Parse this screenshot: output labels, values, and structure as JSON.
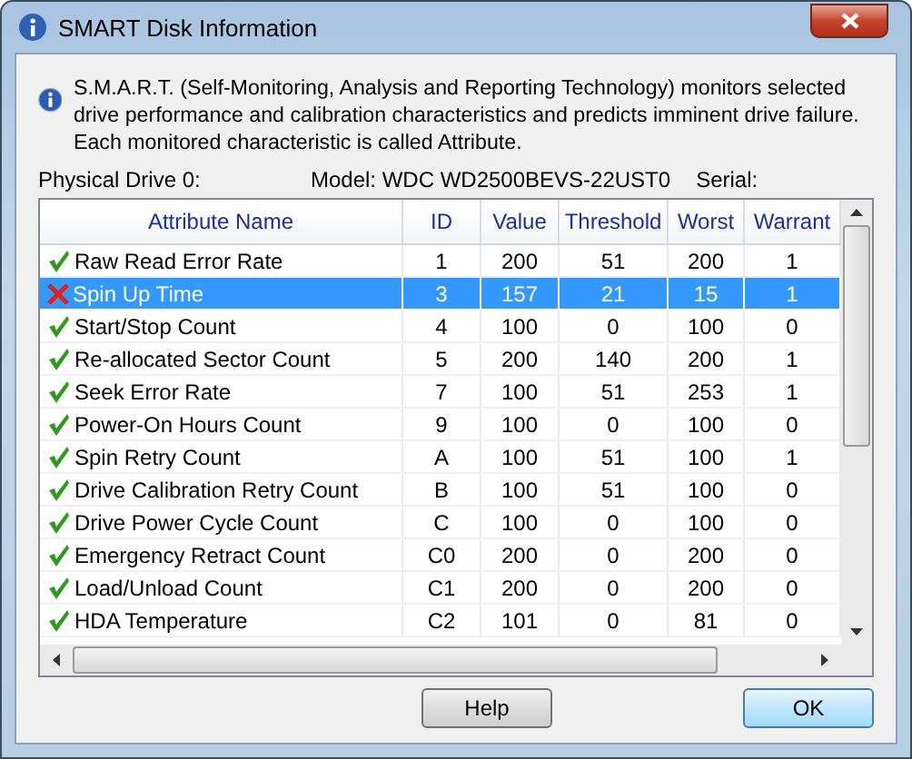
{
  "window": {
    "title": "SMART Disk Information"
  },
  "description": "S.M.A.R.T. (Self-Monitoring, Analysis and Reporting Technology) monitors selected drive performance and calibration characteristics and predicts imminent drive failure. Each monitored characteristic is called Attribute.",
  "drive": {
    "label": "Physical Drive 0:",
    "model": "Model: WDC WD2500BEVS-22UST0",
    "serial_label": "Serial:"
  },
  "table": {
    "columns": [
      "Attribute Name",
      "ID",
      "Value",
      "Threshold",
      "Worst",
      "Warrant"
    ],
    "rows": [
      {
        "kind": "ok",
        "selected": false,
        "cells": [
          "Raw Read Error Rate",
          "1",
          "200",
          "51",
          "200",
          "1"
        ]
      },
      {
        "kind": "fail",
        "selected": true,
        "cells": [
          "Spin Up Time",
          "3",
          "157",
          "21",
          "15",
          "1"
        ]
      },
      {
        "kind": "ok",
        "selected": false,
        "cells": [
          "Start/Stop Count",
          "4",
          "100",
          "0",
          "100",
          "0"
        ]
      },
      {
        "kind": "ok",
        "selected": false,
        "cells": [
          "Re-allocated Sector Count",
          "5",
          "200",
          "140",
          "200",
          "1"
        ]
      },
      {
        "kind": "ok",
        "selected": false,
        "cells": [
          "Seek Error Rate",
          "7",
          "100",
          "51",
          "253",
          "1"
        ]
      },
      {
        "kind": "ok",
        "selected": false,
        "cells": [
          "Power-On Hours Count",
          "9",
          "100",
          "0",
          "100",
          "0"
        ]
      },
      {
        "kind": "ok",
        "selected": false,
        "cells": [
          "Spin Retry Count",
          "A",
          "100",
          "51",
          "100",
          "1"
        ]
      },
      {
        "kind": "ok",
        "selected": false,
        "cells": [
          "Drive Calibration Retry Count",
          "B",
          "100",
          "51",
          "100",
          "0"
        ]
      },
      {
        "kind": "ok",
        "selected": false,
        "cells": [
          "Drive Power Cycle Count",
          "C",
          "100",
          "0",
          "100",
          "0"
        ]
      },
      {
        "kind": "ok",
        "selected": false,
        "cells": [
          "Emergency Retract Count",
          "C0",
          "200",
          "0",
          "200",
          "0"
        ]
      },
      {
        "kind": "ok",
        "selected": false,
        "cells": [
          "Load/Unload Count",
          "C1",
          "200",
          "0",
          "200",
          "0"
        ]
      },
      {
        "kind": "ok",
        "selected": false,
        "cells": [
          "HDA Temperature",
          "C2",
          "101",
          "0",
          "81",
          "0"
        ]
      }
    ]
  },
  "buttons": [
    "Help",
    "OK"
  ]
}
